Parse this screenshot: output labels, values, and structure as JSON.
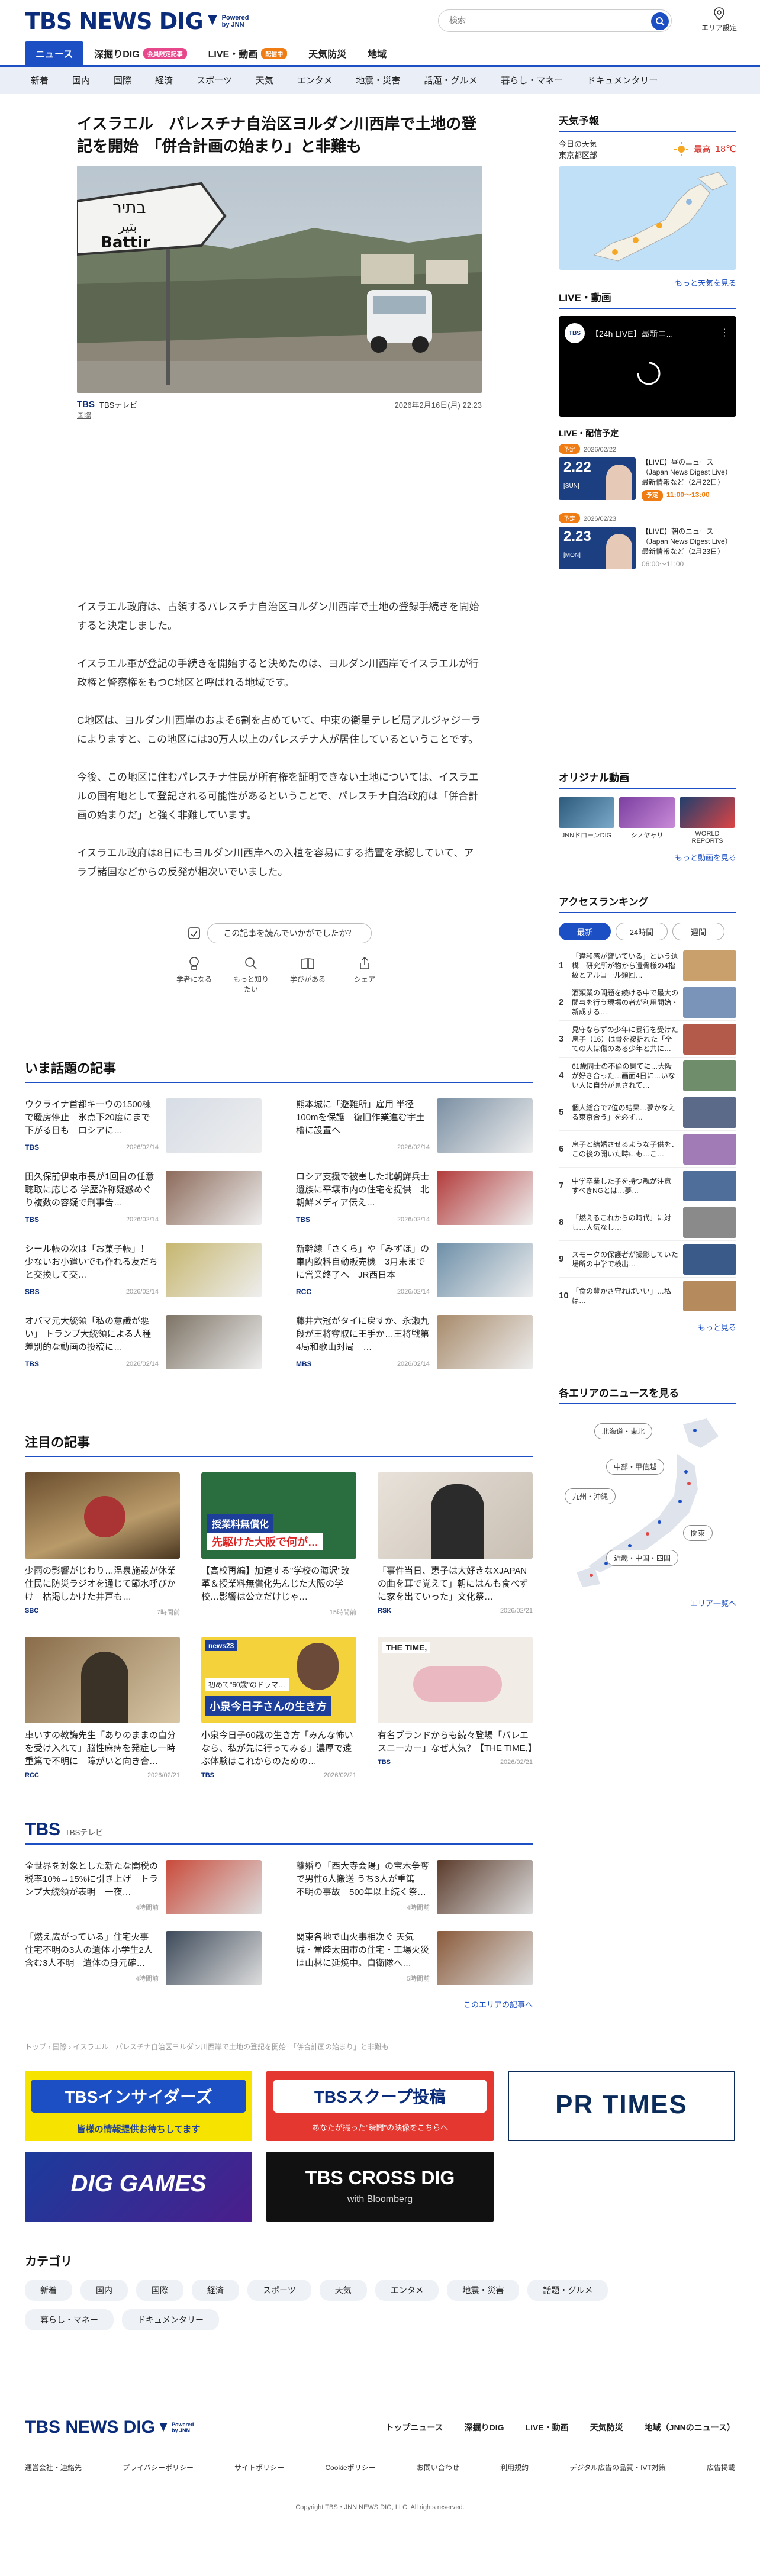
{
  "header": {
    "logo": "TBS NEWS DIG",
    "powered_1": "Powered",
    "powered_2": "by JNN",
    "search_placeholder": "検索",
    "area_setting": "エリア設定"
  },
  "nav_main": [
    {
      "label": "ニュース",
      "active": true
    },
    {
      "label": "深掘りDIG",
      "badge": "会員限定記事"
    },
    {
      "label": "LIVE・動画",
      "badge": "配信中"
    },
    {
      "label": "天気防災"
    },
    {
      "label": "地域"
    }
  ],
  "nav_sub": [
    "新着",
    "国内",
    "国際",
    "経済",
    "スポーツ",
    "天気",
    "エンタメ",
    "地震・災害",
    "話題・グルメ",
    "暮らし・マネー",
    "ドキュメンタリー"
  ],
  "article": {
    "title": "イスラエル　パレスチナ自治区ヨルダン川西岸で土地の登記を開始　「併合計画の始まり」と非難も",
    "sign_text_1": "בתיר",
    "sign_text_2": "بتير",
    "sign_text_3": "Battir",
    "source": "TBSテレビ",
    "source_logo": "TBS",
    "date": "2026年2月16日(月) 22:23",
    "tag": "国際",
    "paragraphs": [
      "イスラエル政府は、占領するパレスチナ自治区ヨルダン川西岸で土地の登録手続きを開始すると決定しました。",
      "イスラエル軍が登記の手続きを開始すると決めたのは、ヨルダン川西岸でイスラエルが行政権と警察権をもつC地区と呼ばれる地域です。",
      "C地区は、ヨルダン川西岸のおよそ6割を占めていて、中東の衛星テレビ局アルジャジーラによりますと、この地区には30万人以上のパレスチナ人が居住しているということです。",
      "今後、この地区に住むパレスチナ住民が所有権を証明できない土地については、イスラエルの国有地として登記される可能性があるということで、パレスチナ自治政府は「併合計画の始まりだ」と強く非難しています。",
      "イスラエル政府は8日にもヨルダン川西岸への入植を容易にする措置を承認していて、アラブ諸国などからの反発が相次いでいました。"
    ],
    "feedback_q": "この記事を読んでいかがでしたか？",
    "feedback": [
      "学者になる",
      "もっと知りたい",
      "学びがある",
      "シェア"
    ]
  },
  "sidebar": {
    "weather_h": "天気予報",
    "weather_sub1": "今日の天気",
    "weather_sub2": "東京都区部",
    "weather_max_label": "最高",
    "weather_max": "18℃",
    "weather_more": "もっと天気を見る",
    "live_h": "LIVE・動画",
    "live_title": "【24h LIVE】最新ニ...",
    "sched_h": "LIVE・配信予定",
    "sched": [
      {
        "pill": "予定",
        "date": "2026/02/22",
        "thumb_date": "2.22",
        "thumb_day": "[SUN]",
        "title": "【LIVE】昼のニュース（Japan News Digest Live）最新情報など（2月22日）",
        "time_pill": "予定",
        "time": "11:00～13:00"
      },
      {
        "pill": "予定",
        "date": "2026/02/23",
        "thumb_date": "2.23",
        "thumb_day": "[MON]",
        "title": "【LIVE】朝のニュース（Japan News Digest Live）最新情報など（2月23日）",
        "time_pill": "",
        "time": "06:00～11:00"
      }
    ],
    "orig_h": "オリジナル動画",
    "orig": [
      "JNNドローンDIG",
      "シノヤャリ",
      "WORLD REPORTS"
    ],
    "orig_more": "もっと動画を見る",
    "rank_h": "アクセスランキング",
    "rank_tabs": [
      "最新",
      "24時間",
      "週間"
    ],
    "ranking": [
      "「違和感が響いている」という遺構　研究所が物から遺骨様の4指紋とアルコール類回…",
      "酒類業の問題を続ける中で最大の関与を行う現場の者が利用開始・新成する…",
      "見守ならずの少年に暴行を受けた息子（16）は骨を複折れた「全ての人は傷のある少年と共に…",
      "61歳同士の不倫の果てに…大阪が好き合った…画面4日に…いない人に自分が見されて…",
      "個人総合で7位の結果…夢かなえる東京合う」を必ず…",
      "息子と結婚させるような子供を、この後の開いた時にも…こ…",
      "中学卒業した子を持つ親が注意すべきNGとは…夢…",
      "「燃えるこれからの時代」に対し…人気なし…",
      "スモークの保護者が撮影していた場所の中学で検出…",
      "「食の豊かさ守ればいい」…私は…"
    ],
    "rank_more": "もっと見る",
    "area_h": "各エリアのニュースを見る",
    "areas": [
      "北海道・東北",
      "中部・甲信越",
      "九州・沖縄",
      "関東",
      "近畿・中国・四国"
    ],
    "area_more": "エリア一覧へ"
  },
  "topics": {
    "title": "いま話題の記事",
    "items": [
      {
        "text": "ウクライナ首都キーウの1500棟で暖房停止　氷点下20度にまで下がる日も　ロシアに…",
        "src": "TBS",
        "date": "2026/02/14"
      },
      {
        "text": "熊本城に「避難所」雇用 半径100mを保護　復旧作業進む宇土櫓に設置へ",
        "src": "",
        "date": "2026/02/14"
      },
      {
        "text": "田久保前伊東市長が1回目の任意聴取に応じる 学歴詐称疑惑めぐり複数の容疑で刑事告…",
        "src": "TBS",
        "date": "2026/02/14"
      },
      {
        "text": "ロシア支援で被害した北朝鮮兵士遺族に平壌市内の住宅を提供　北朝鮮メディア伝え…",
        "src": "TBS",
        "date": "2026/02/14"
      },
      {
        "text": "シール帳の次は「お菓子帳」！ 少ないお小遣いでも作れる友だちと交換して交…",
        "src": "SBS",
        "date": "2026/02/14"
      },
      {
        "text": "新幹線「さくら」や「みずほ」の車内飲料自動販売機　3月末までに営業終了へ　JR西日本",
        "src": "RCC",
        "date": "2026/02/14"
      },
      {
        "text": "オバマ元大統領「私の意識が悪い」 トランプ大統領による人種差別的な動画の投稿に…",
        "src": "TBS",
        "date": "2026/02/14"
      },
      {
        "text": "藤井六冠がタイに戻すか、永瀬九段が王将奪取に王手か…王将戦第4局和歌山対局　…",
        "src": "MBS",
        "date": "2026/02/14"
      }
    ]
  },
  "featured": {
    "title": "注目の記事",
    "items": [
      {
        "text": "少雨の影響がじわり…温泉施設が休業　住民に防災ラジオを通じて節水呼びかけ　枯渇しかけた井戸も…",
        "src": "SBC",
        "date": "7時間前"
      },
      {
        "text": "【高校再編】加速する\"学校の海沢\"改革＆授業料無償化先んじた大阪の学校…影響は公立だけじゃ…",
        "src": "",
        "date": "15時間前"
      },
      {
        "text": "「事件当日、恵子は大好きなXJAPANの曲を耳で覚えて」朝にはんも食べずに家を出ていった」文化祭…",
        "src": "RSK",
        "date": "2026/02/21"
      },
      {
        "text": "車いすの教誨先生「ありのままの自分を受け入れて」脳性麻痺を発症し一時重篤で不明に　障がいと向き合…",
        "src": "RCC",
        "date": "2026/02/21"
      },
      {
        "text": "小泉今日子60歳の生き方「みんな怖いなら、私が先に行ってみる」濃厚で遠ぶ体験はこれからのための…",
        "src": "TBS",
        "date": "2026/02/21"
      },
      {
        "text": "有名ブランドからも続々登場「バレエスニーカー」なぜ人気？【THE TIME,】",
        "src": "TBS",
        "date": "2026/02/21"
      }
    ],
    "thumb_label_2a": "授業料無償化",
    "thumb_label_2b": "先駆けた大阪で何が…",
    "thumb_label_5a": "news23",
    "thumb_label_5b": "初めて\"60歳\"のドラマ…",
    "thumb_label_5c": "小泉今日子さんの生き方",
    "thumb_label_6": "THE TIME,"
  },
  "tbs_section": {
    "logo": "TBS",
    "sub": "TBSテレビ",
    "items": [
      {
        "text": "全世界を対象とした新たな関税の税率10%→15%に引き上げ　トランプ大統領が表明　一夜…",
        "date": "4時間前"
      },
      {
        "text": "離婚り「西大寺会陽」の宝木争奪で男性6人搬送 うち3人が重篤　不明の事故　500年以上続く祭…",
        "date": "4時間前"
      },
      {
        "text": "「燃え広がっている」住宅火事 住宅不明の3人の遺体 小学生2人含む3人不明　遺体の身元確…",
        "date": "4時間前"
      },
      {
        "text": "関東各地で山火事相次ぐ 天気城・常陸太田市の住宅・工場火災は山林に延焼中。自衛隊へ…",
        "date": "5時間前"
      }
    ],
    "more": "このエリアの記事へ"
  },
  "breadcrumb": "トップ › 国際 › イスラエル　パレスチナ自治区ヨルダン川西岸で土地の登記を開始　「併合計画の始まり」と非難も",
  "banners": {
    "b1_title": "TBSインサイダーズ",
    "b1_sub": "皆様の情報提供お待ちしてます",
    "b2_title": "TBSスクープ投稿",
    "b2_sub": "あなたが撮った\"瞬間\"の映像をこちらへ",
    "b3": "PR TIMES",
    "b4": "DIG GAMES",
    "b5_title": "TBS CROSS DIG",
    "b5_sub": "with Bloomberg"
  },
  "categories": {
    "title": "カテゴリ",
    "items": [
      "新着",
      "国内",
      "国際",
      "経済",
      "スポーツ",
      "天気",
      "エンタメ",
      "地震・災害",
      "話題・グルメ",
      "暮らし・マネー",
      "ドキュメンタリー"
    ]
  },
  "footer": {
    "nav": [
      "トップニュース",
      "深掘りDIG",
      "LIVE・動画",
      "天気防災",
      "地域（JNNのニュース）"
    ],
    "links": [
      "運営会社・連絡先",
      "プライバシーポリシー",
      "サイトポリシー",
      "Cookieポリシー",
      "お問い合わせ",
      "利用規約",
      "デジタル広告の品質・IVT対策",
      "広告掲載"
    ],
    "copyright": "Copyright TBS・JNN NEWS DIG, LLC. All rights reserved."
  },
  "colors": {
    "brand": "#0b2c7a",
    "accent": "#1d4fc4",
    "live": "#ef7d13",
    "member": "#e7478b"
  }
}
